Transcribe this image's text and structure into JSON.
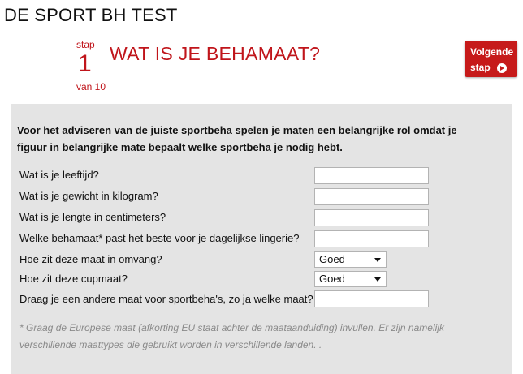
{
  "header": {
    "title": "DE SPORT BH TEST"
  },
  "step": {
    "label_top": "stap",
    "number": "1",
    "label_bottom": "van 10",
    "heading": "WAT IS JE BEHAMAAT?"
  },
  "next_button": {
    "line1": "Volgende",
    "line2": "stap",
    "icon": "arrow-right-circle-icon"
  },
  "intro": "Voor het adviseren van de juiste sportbeha spelen je maten een belangrijke rol omdat je figuur in belangrijke mate bepaalt welke sportbeha je nodig hebt.",
  "questions": [
    {
      "label": "Wat is je leeftijd?",
      "type": "text",
      "value": ""
    },
    {
      "label": "Wat is je gewicht in kilogram?",
      "type": "text",
      "value": ""
    },
    {
      "label": "Wat is je lengte in centimeters?",
      "type": "text",
      "value": ""
    },
    {
      "label": "Welke behamaat* past het beste voor je dagelijkse lingerie?",
      "type": "text",
      "value": ""
    },
    {
      "label": "Hoe zit deze maat in omvang?",
      "type": "select",
      "value": "Goed"
    },
    {
      "label": "Hoe zit deze cupmaat?",
      "type": "select",
      "value": "Goed"
    },
    {
      "label": "Draag je een andere maat voor sportbeha's, zo ja welke maat?",
      "type": "text",
      "value": ""
    }
  ],
  "footnote": "* Graag de Europese maat (afkorting EU staat achter de maataanduiding) invullen. Er zijn namelijk verschillende maattypes die gebruikt worden in verschillende landen. .",
  "colors": {
    "brand_red": "#c0151b",
    "button_red": "#c61a1a",
    "panel_gray": "#e4e4e4"
  }
}
